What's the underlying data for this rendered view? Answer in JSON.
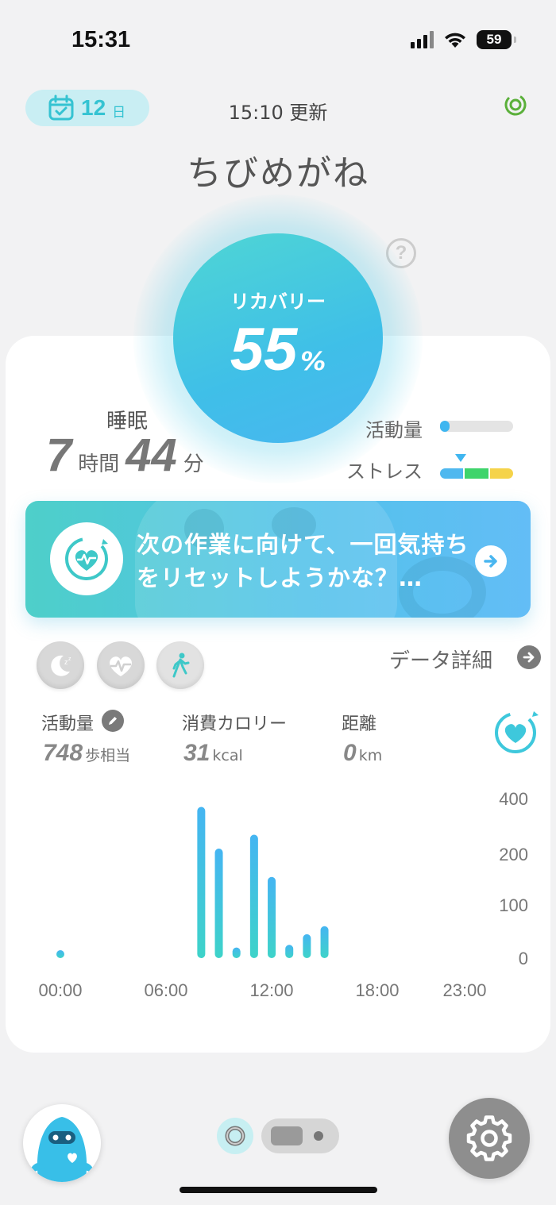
{
  "status_bar": {
    "time": "15:31",
    "battery": "59"
  },
  "header": {
    "day_count": "12",
    "day_unit": "日",
    "updated": "15:10 更新",
    "username": "ちびめがね"
  },
  "recovery": {
    "label": "リカバリー",
    "value": "55",
    "unit": "%"
  },
  "sleep": {
    "label": "睡眠",
    "hours": "7",
    "hours_unit": "時間",
    "minutes": "44",
    "minutes_unit": "分"
  },
  "activity": {
    "label": "活動量",
    "level": 0.12
  },
  "stress": {
    "label": "ストレス",
    "segments": [
      "#4fb8ef",
      "#3ed46b",
      "#f5d34a"
    ],
    "marker_segment": 0
  },
  "banner": {
    "text": "次の作業に向けて、一回気持ちをリセットしようかな？…"
  },
  "detail_link": "データ詳細",
  "stats": {
    "activity_label": "活動量",
    "activity_value": "748",
    "activity_unit": "歩相当",
    "calories_label": "消費カロリー",
    "calories_value": "31",
    "calories_unit": "kcal",
    "distance_label": "距離",
    "distance_value": "0",
    "distance_unit": "km"
  },
  "chart_data": {
    "type": "bar",
    "title": "",
    "xlabel": "",
    "ylabel": "",
    "x_ticks": [
      "00:00",
      "06:00",
      "12:00",
      "18:00",
      "23:00"
    ],
    "y_ticks": [
      "0",
      "100",
      "200",
      "400"
    ],
    "ylim": [
      0,
      400
    ],
    "x": [
      0,
      8,
      9,
      10,
      11,
      12,
      13,
      14,
      15,
      16
    ],
    "values": [
      8,
      370,
      220,
      20,
      270,
      155,
      25,
      45,
      60,
      0
    ],
    "colors": {
      "top": "#45b5f2",
      "bottom": "#3ed3c9"
    }
  }
}
